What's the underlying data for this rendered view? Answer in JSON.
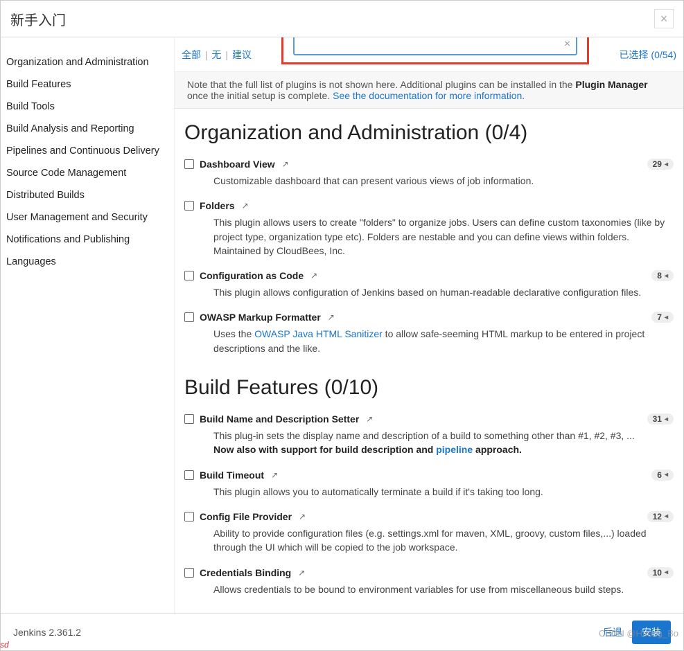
{
  "dialog": {
    "title": "新手入门",
    "close_label": "×"
  },
  "sidebar": {
    "items": [
      {
        "label": "Organization and Administration"
      },
      {
        "label": "Build Features"
      },
      {
        "label": "Build Tools"
      },
      {
        "label": "Build Analysis and Reporting"
      },
      {
        "label": "Pipelines and Continuous Delivery"
      },
      {
        "label": "Source Code Management"
      },
      {
        "label": "Distributed Builds"
      },
      {
        "label": "User Management and Security"
      },
      {
        "label": "Notifications and Publishing"
      },
      {
        "label": "Languages"
      }
    ]
  },
  "filters": {
    "all": "全部",
    "none": "无",
    "suggested": "建议"
  },
  "search": {
    "value": "",
    "placeholder": ""
  },
  "selected": {
    "label": "已选择 (0/54)"
  },
  "banner": {
    "prefix": "Note that the full list of plugins is not shown here. Additional plugins can be installed in the ",
    "bold": "Plugin Manager",
    "mid": " once the initial setup is complete. ",
    "link": "See the documentation for more information",
    "suffix": "."
  },
  "sections": [
    {
      "title": "Organization and Administration (0/4)",
      "plugins": [
        {
          "name": "Dashboard View",
          "badge": "29",
          "desc": "Customizable dashboard that can present various views of job information."
        },
        {
          "name": "Folders",
          "badge": "",
          "desc": "This plugin allows users to create \"folders\" to organize jobs. Users can define custom taxonomies (like by project type, organization type etc). Folders are nestable and you can define views within folders. Maintained by CloudBees, Inc."
        },
        {
          "name": "Configuration as Code",
          "badge": "8",
          "desc": "This plugin allows configuration of Jenkins based on human-readable declarative configuration files."
        },
        {
          "name": "OWASP Markup Formatter",
          "badge": "7",
          "desc_pre": "Uses the ",
          "desc_link": "OWASP Java HTML Sanitizer",
          "desc_post": " to allow safe-seeming HTML markup to be entered in project descriptions and the like."
        }
      ]
    },
    {
      "title": "Build Features (0/10)",
      "plugins": [
        {
          "name": "Build Name and Description Setter",
          "badge": "31",
          "desc_pre": "This plug-in sets the display name and description of a build to something other than #1, #2, #3, ...",
          "desc_bold": "Now also with support for build description and ",
          "desc_link": "pipeline",
          "desc_post": " approach."
        },
        {
          "name": "Build Timeout",
          "badge": "6",
          "desc": "This plugin allows you to automatically terminate a build if it's taking too long."
        },
        {
          "name": "Config File Provider",
          "badge": "12",
          "desc": "Ability to provide configuration files (e.g. settings.xml for maven, XML, groovy, custom files,...) loaded through the UI which will be copied to the job workspace."
        },
        {
          "name": "Credentials Binding",
          "badge": "10",
          "desc": "Allows credentials to be bound to environment variables for use from miscellaneous build steps."
        }
      ]
    }
  ],
  "footer": {
    "version": "Jenkins 2.361.2",
    "back": "后退",
    "install": "安装"
  },
  "watermark": "CSDN @Huang_Bo",
  "sd": "sd"
}
